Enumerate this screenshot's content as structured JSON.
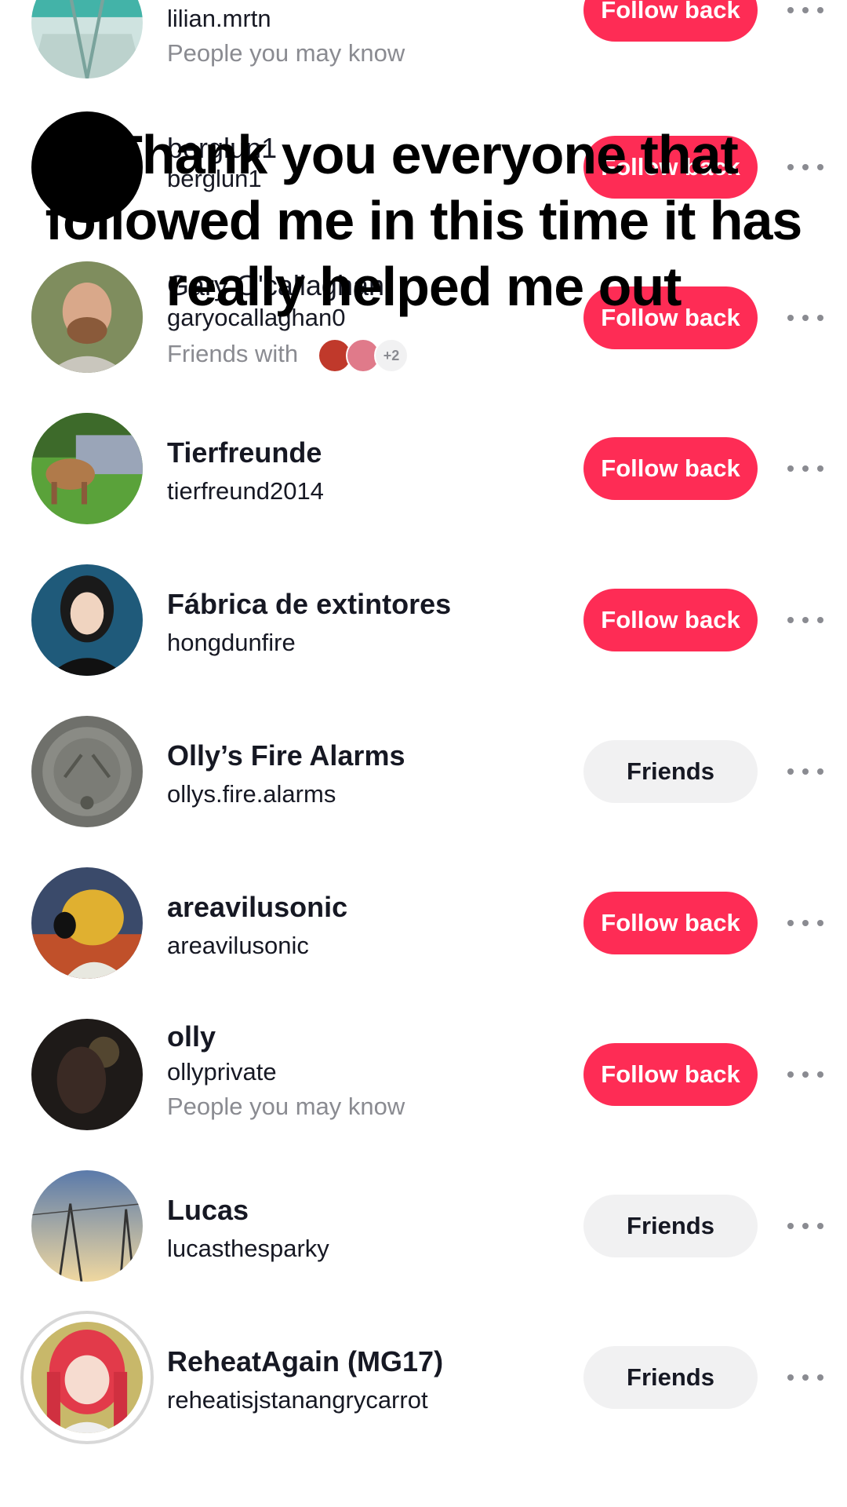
{
  "overlay_caption": "Thank you everyone that followed me in this time it has really helped me out",
  "follow_back_label": "Follow back",
  "friends_label": "Friends",
  "colors": {
    "accent": "#fe2c55",
    "secondary_text": "#8a8b91",
    "friends_bg": "#f1f1f2"
  },
  "users": [
    {
      "name": "",
      "handle": "lilian.mrtn",
      "sub": "People you may know",
      "button": "Follow back"
    },
    {
      "name": "berglun1",
      "handle": "berglun1",
      "sub": "",
      "button": "Follow back"
    },
    {
      "name": "Gary O'callaghan",
      "handle": "garyocallaghan0",
      "sub": "Friends with",
      "mutual_more": "+2",
      "button": "Follow back"
    },
    {
      "name": "Tierfreunde",
      "handle": "tierfreund2014",
      "sub": "",
      "button": "Follow back"
    },
    {
      "name": "Fábrica de extintores",
      "handle": "hongdunfire",
      "sub": "",
      "button": "Follow back"
    },
    {
      "name": "Olly’s Fire Alarms",
      "handle": "ollys.fire.alarms",
      "sub": "",
      "button": "Friends"
    },
    {
      "name": "areavilusonic",
      "handle": "areavilusonic",
      "sub": "",
      "button": "Follow back"
    },
    {
      "name": "olly",
      "handle": "ollyprivate",
      "sub": "People you may know",
      "button": "Follow back"
    },
    {
      "name": "Lucas",
      "handle": "lucasthesparky",
      "sub": "",
      "button": "Friends"
    },
    {
      "name": "ReheatAgain (MG17)",
      "handle": "reheatisjstanangrycarrot",
      "sub": "",
      "button": "Friends"
    }
  ]
}
